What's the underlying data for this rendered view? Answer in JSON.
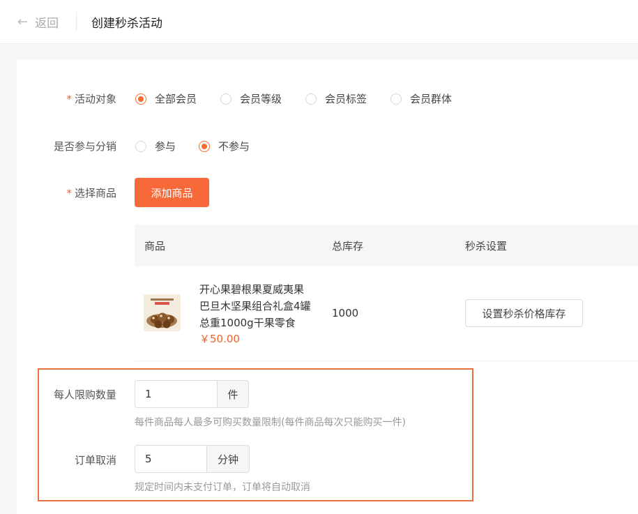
{
  "header": {
    "back_label": "返回",
    "title": "创建秒杀活动"
  },
  "form": {
    "target": {
      "label": "活动对象",
      "required": true,
      "options": [
        "全部会员",
        "会员等级",
        "会员标签",
        "会员群体"
      ],
      "selected": "全部会员"
    },
    "distribution": {
      "label": "是否参与分销",
      "options": [
        "参与",
        "不参与"
      ],
      "selected": "不参与"
    },
    "goods": {
      "label": "选择商品",
      "required": true,
      "add_button_label": "添加商品",
      "table": {
        "columns": [
          "商品",
          "总库存",
          "秒杀设置"
        ],
        "rows": [
          {
            "name": "开心果碧根果夏威夷果巴旦木坚果组合礼盒4罐总重1000g干果零食",
            "price": "￥50.00",
            "stock": "1000",
            "action_label": "设置秒杀价格库存"
          }
        ]
      }
    },
    "limit": {
      "label": "每人限购数量",
      "value": "1",
      "unit": "件",
      "hint": "每件商品每人最多可购买数量限制(每件商品每次只能购买一件)"
    },
    "cancel": {
      "label": "订单取消",
      "value": "5",
      "unit": "分钟",
      "hint": "规定时间内未支付订单，订单将自动取消"
    }
  },
  "colors": {
    "accent": "#f8693a",
    "radio_checked": "#f36c31",
    "price": "#f0622d",
    "highlight_border": "#e8703c"
  }
}
